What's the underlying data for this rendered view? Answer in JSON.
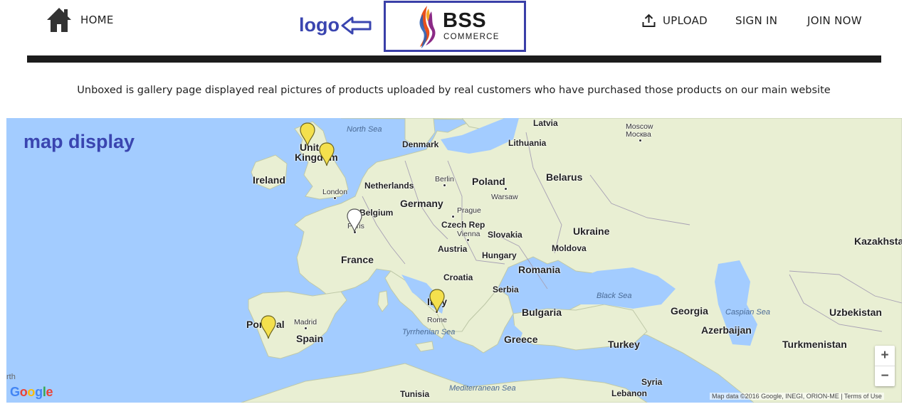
{
  "header": {
    "home_label": "HOME",
    "logo_annotation": "logo",
    "logo_brand": "BSS",
    "logo_sub": "COMMERCE",
    "upload_label": "UPLOAD",
    "signin_label": "SIGN IN",
    "join_label": "JOIN NOW",
    "icons": [
      "home-icon",
      "left-arrow-icon",
      "flame-logo-icon",
      "upload-icon"
    ]
  },
  "intro_text": "Unboxed is gallery page displayed real pictures of products uploaded by real customers who have purchased those products on our main website",
  "map": {
    "annotation": "map display",
    "countries": [
      "Latvia",
      "Lithuania",
      "Denmark",
      "Ireland",
      "Uniteo",
      "Kingdom",
      "Netherlands",
      "Poland",
      "Belarus",
      "Germany",
      "Belgium",
      "Czech Rep",
      "Slovakia",
      "Ukraine",
      "Austria",
      "Moldova",
      "Hungary",
      "Romania",
      "France",
      "Croatia",
      "Serbia",
      "Bulgaria",
      "Georgia",
      "Kazakhsta",
      "Uzbekistan",
      "Azerbaijan",
      "Turkmenistan",
      "Turkey",
      "Greece",
      "Spain",
      "Por",
      "al",
      "Italy",
      "Syria",
      "Lebanon",
      "Tunisia"
    ],
    "cities": [
      "Moscow",
      "Москва",
      "Berlin",
      "Warsaw",
      "London",
      "Prague",
      "Paris",
      "Vienna",
      "Madrid",
      "Rome"
    ],
    "seas": [
      "North Sea",
      "Black Sea",
      "Caspian Sea",
      "Tyrrhenian Sea",
      "Mediterranean Sea"
    ],
    "edge_text": "rth",
    "zoom_in": "+",
    "zoom_out": "−",
    "google_logo": "Google",
    "attribution": "Map data ©2016 Google, INEGI, ORION-ME | Terms of Use",
    "pin_colors": {
      "yellow": "#f4e04d",
      "white": "#ffffff"
    },
    "pins": [
      {
        "name": "United Kingdom North",
        "color": "yellow"
      },
      {
        "name": "United Kingdom",
        "color": "yellow"
      },
      {
        "name": "Paris",
        "color": "white"
      },
      {
        "name": "Italy",
        "color": "yellow"
      },
      {
        "name": "Portugal",
        "color": "yellow"
      }
    ]
  },
  "colors": {
    "accent_blue": "#3a45b0",
    "water": "#a3ccff",
    "land": "#e8f0d4",
    "header_bar": "#1c1c1c"
  }
}
